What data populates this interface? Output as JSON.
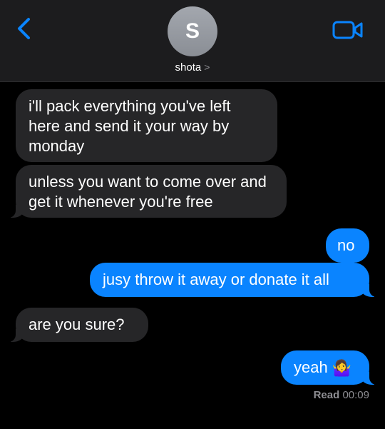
{
  "header": {
    "avatar_initial": "S",
    "contact_name": "shota",
    "contact_chevron": ">",
    "icons": {
      "back": "chevron-left-icon",
      "video": "video-camera-icon"
    },
    "accent": "#0a84ff"
  },
  "messages": [
    {
      "from": "them",
      "text": "i'll pack everything you've left here and send it your way by monday"
    },
    {
      "from": "them",
      "text": "unless you want to come over and get it whenever you're free"
    },
    {
      "from": "me",
      "text": "no"
    },
    {
      "from": "me",
      "text": "jusy throw it away or donate it all"
    },
    {
      "from": "them",
      "text": "are you sure?"
    },
    {
      "from": "me",
      "text": "yeah",
      "emoji": "🤷‍♀️"
    }
  ],
  "receipt": {
    "label": "Read",
    "time": "00:09"
  },
  "colors": {
    "incoming": "#262628",
    "outgoing": "#0a84ff",
    "background": "#000000"
  }
}
